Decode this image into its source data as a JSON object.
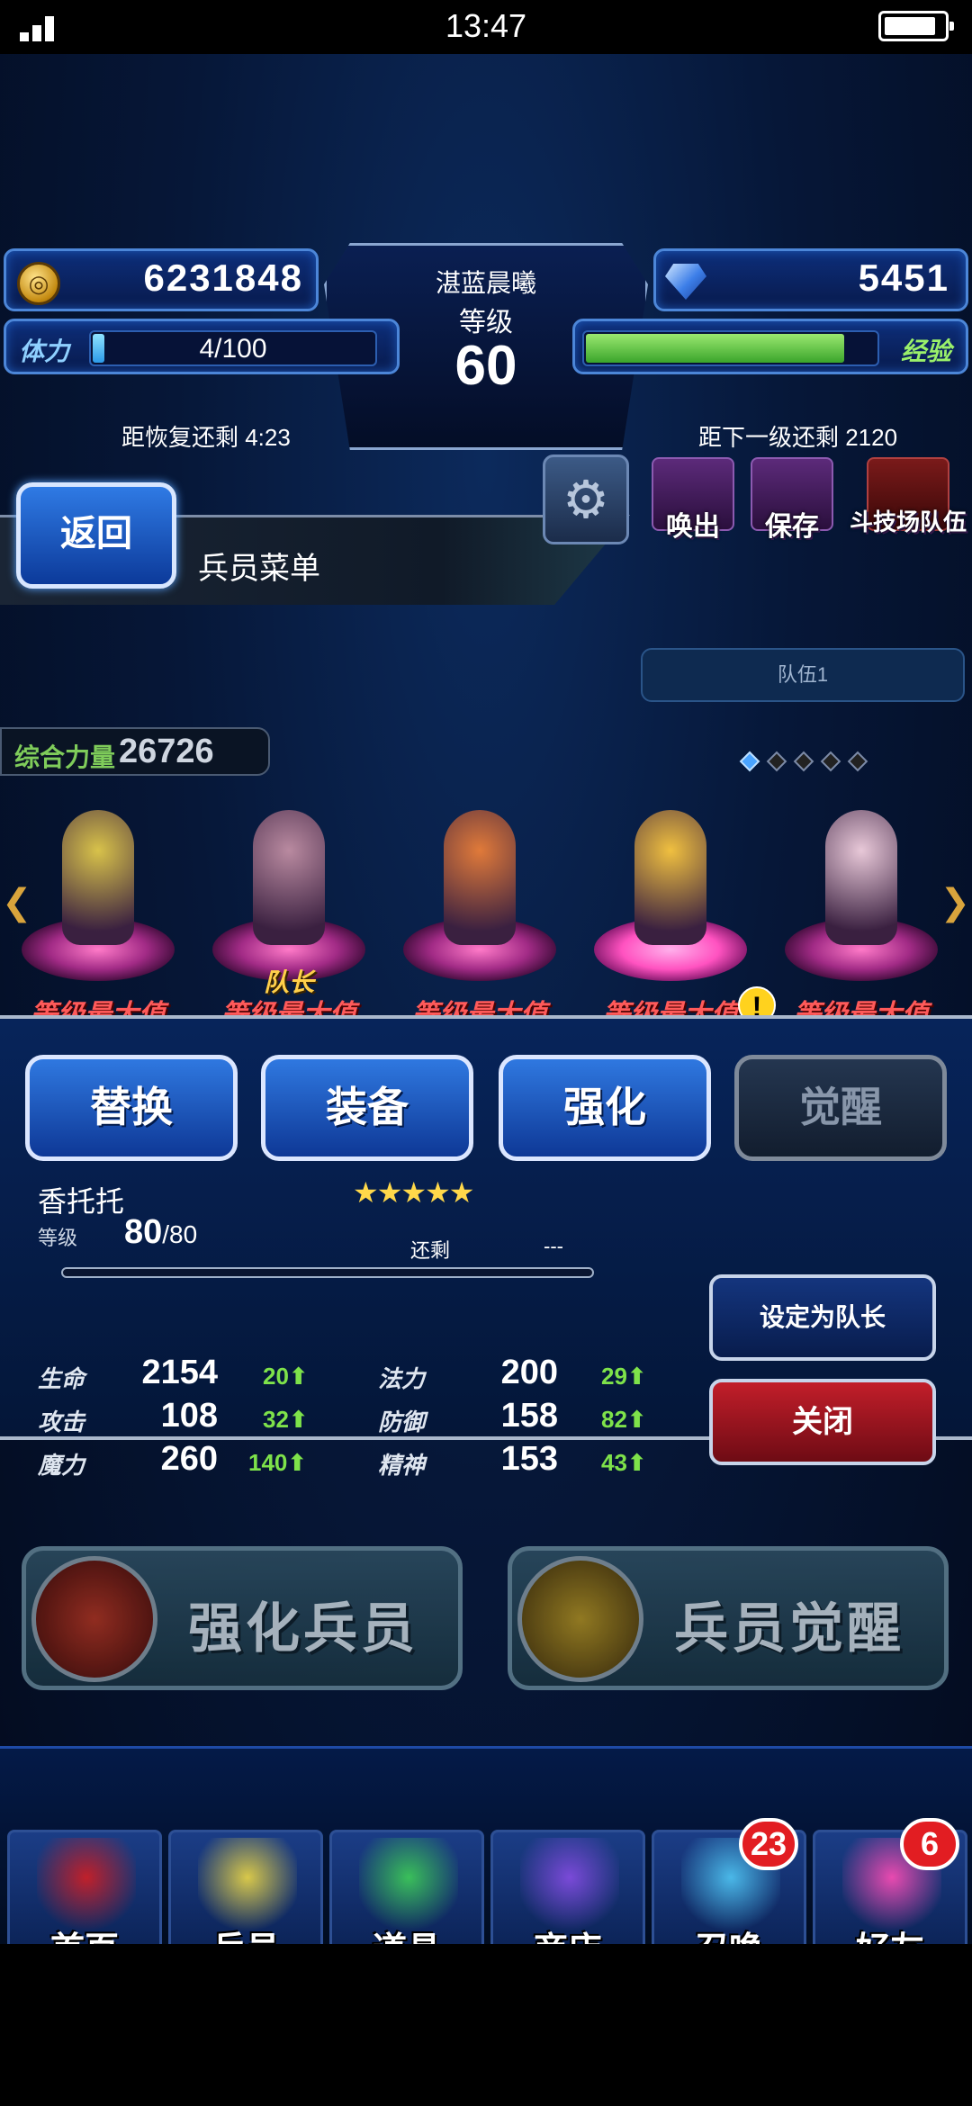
{
  "status_bar": {
    "time": "13:47"
  },
  "hud": {
    "gil": "6231848",
    "gems": "5451",
    "player_name": "湛蓝晨曦",
    "level_label": "等级",
    "level": "60",
    "stamina_label": "体力",
    "stamina_value": "4/100",
    "stamina_fraction": 0.04,
    "recover_text": "距恢复还剩 4:23",
    "exp_label": "经验",
    "exp_fraction": 0.88,
    "next_level_text": "距下一级还剩 2120"
  },
  "header": {
    "back_label": "返回",
    "title": "兵员菜单",
    "actions": [
      {
        "label": "唤出"
      },
      {
        "label": "保存"
      },
      {
        "label": "斗技场队伍"
      }
    ]
  },
  "party": {
    "tab_label": "队伍1",
    "power_label": "综合力量",
    "power_value": "26726",
    "page_count": 5,
    "current_page": 0
  },
  "units": [
    {
      "maxlv": "等级最大值",
      "color": "#d8c24a"
    },
    {
      "maxlv": "等级最大值",
      "leader": "队长",
      "color": "#b98aa0"
    },
    {
      "maxlv": "等级最大值",
      "color": "#e07a3a"
    },
    {
      "maxlv": "等级最大值",
      "color": "#f0c040",
      "selected": true,
      "alert": "!"
    },
    {
      "maxlv": "等级最大值",
      "color": "#e8c8d8"
    }
  ],
  "detail": {
    "tabs": [
      "替换",
      "装备",
      "强化",
      "觉醒"
    ],
    "unit_name": "香托托",
    "stars": "★★★★★",
    "level_label": "等级",
    "level_cur": "80",
    "level_max": "/80",
    "remain_label": "还剩",
    "remain_value": "---",
    "stats": [
      {
        "k": "生命",
        "v": "2154",
        "inc": "20⬆"
      },
      {
        "k": "法力",
        "v": "200",
        "inc": "29⬆"
      },
      {
        "k": "攻击",
        "v": "108",
        "inc": "32⬆"
      },
      {
        "k": "防御",
        "v": "158",
        "inc": "82⬆"
      },
      {
        "k": "魔力",
        "v": "260",
        "inc": "140⬆"
      },
      {
        "k": "精神",
        "v": "153",
        "inc": "43⬆"
      }
    ],
    "set_leader_label": "设定为队长",
    "close_label": "关闭"
  },
  "big_buttons": {
    "enhance": "强化兵员",
    "awaken": "兵员觉醒"
  },
  "nav": [
    {
      "label": "首页",
      "color": "#c0202a"
    },
    {
      "label": "兵员",
      "color": "#d8c84a"
    },
    {
      "label": "道具",
      "color": "#3abf5a"
    },
    {
      "label": "商店",
      "color": "#7a4ad8"
    },
    {
      "label": "召唤",
      "color": "#4ab8e8",
      "badge": "23"
    },
    {
      "label": "好友",
      "color": "#e84ab0",
      "badge": "6"
    }
  ]
}
